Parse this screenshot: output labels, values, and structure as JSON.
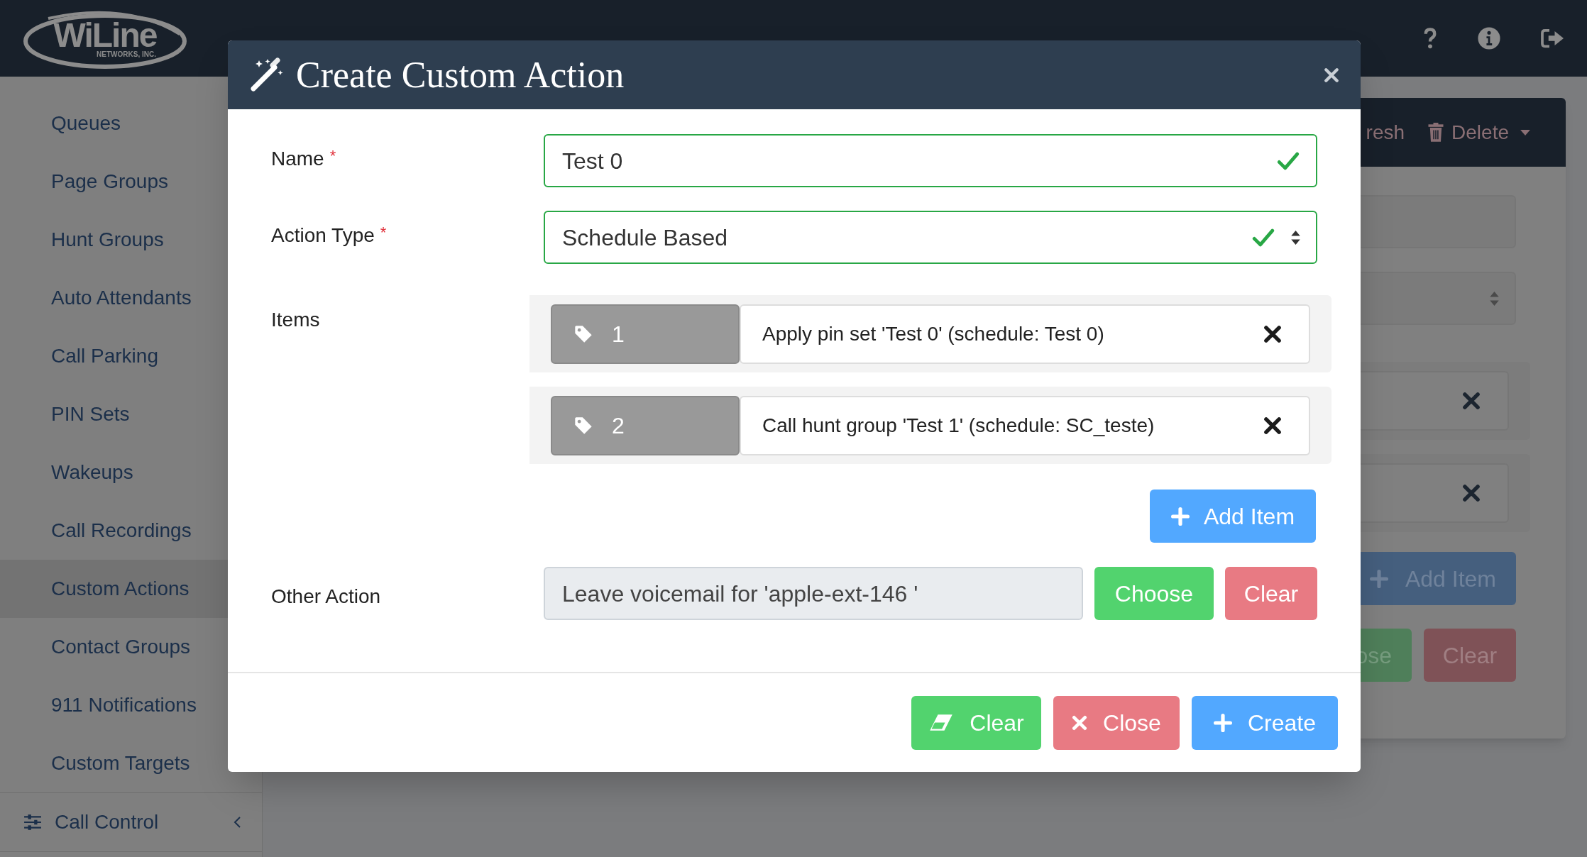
{
  "top_bar": {
    "logo": {
      "name": "WiLine",
      "tagline": "NETWORKS, INC."
    }
  },
  "sidebar": {
    "items": [
      {
        "label": "Queues",
        "selected": false
      },
      {
        "label": "Page Groups",
        "selected": false
      },
      {
        "label": "Hunt Groups",
        "selected": false
      },
      {
        "label": "Auto Attendants",
        "selected": false
      },
      {
        "label": "Call Parking",
        "selected": false
      },
      {
        "label": "PIN Sets",
        "selected": false
      },
      {
        "label": "Wakeups",
        "selected": false
      },
      {
        "label": "Call Recordings",
        "selected": false
      },
      {
        "label": "Custom Actions",
        "selected": true
      },
      {
        "label": "Contact Groups",
        "selected": false
      },
      {
        "label": "911 Notifications",
        "selected": false
      },
      {
        "label": "Custom Targets",
        "selected": false
      }
    ],
    "section": {
      "label": "Call Control",
      "expanded": false
    }
  },
  "background_panel": {
    "toolbar": [
      {
        "kind": "text",
        "label": "resh"
      },
      {
        "kind": "menu",
        "label": "Delete"
      }
    ],
    "add_button": "Add Item",
    "buttons": [
      {
        "kind": "success",
        "label": "ose"
      },
      {
        "kind": "danger",
        "label": "Clear"
      }
    ]
  },
  "dialog": {
    "title": "Create Custom Action",
    "fields": [
      {
        "kind": "text",
        "label": "Name",
        "required_mark": "*",
        "value": "Test 0",
        "valid": true
      },
      {
        "kind": "select",
        "label": "Action Type",
        "required_mark": "*",
        "value": "Schedule Based",
        "valid": true
      }
    ],
    "items": {
      "label": "Items",
      "rows": [
        {
          "number": "1",
          "text": "Apply pin set 'Test 0' (schedule: Test 0)"
        },
        {
          "number": "2",
          "text": "Call hunt group 'Test 1' (schedule: SC_teste)"
        }
      ],
      "add_button": "Add Item"
    },
    "other_action": {
      "label": "Other Action",
      "value": "Leave voicemail for 'apple-ext-146 '",
      "buttons": [
        {
          "kind": "success",
          "label": "Choose"
        },
        {
          "kind": "danger",
          "label": "Clear"
        }
      ]
    },
    "footer_buttons": [
      {
        "kind": "clear",
        "label": "Clear"
      },
      {
        "kind": "close",
        "label": "Close"
      },
      {
        "kind": "create",
        "label": "Create"
      }
    ]
  }
}
